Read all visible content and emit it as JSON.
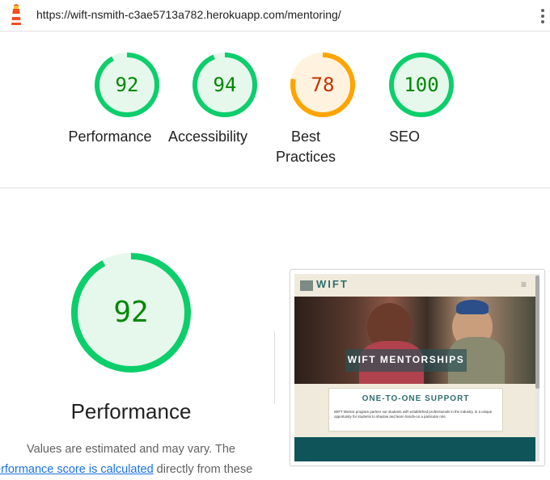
{
  "url_bar": {
    "url": "https://wift-nsmith-c3ae5713a782.herokuapp.com/mentoring/",
    "logo_icon": "lighthouse-icon",
    "menu_icon": "kebab-menu-icon"
  },
  "gauges": [
    {
      "label": "Performance",
      "score": "92",
      "color": "#0cce6b",
      "text_color": "#008800",
      "fill": "#e6f7ec"
    },
    {
      "label": "Accessibility",
      "score": "94",
      "color": "#0cce6b",
      "text_color": "#008800",
      "fill": "#e6f7ec"
    },
    {
      "label": "Best Practices",
      "score": "78",
      "color": "#ffa400",
      "text_color": "#c33300",
      "fill": "#fff3e0"
    },
    {
      "label": "SEO",
      "score": "100",
      "color": "#0cce6b",
      "text_color": "#008800",
      "fill": "#e6f7ec"
    }
  ],
  "performance_section": {
    "score": "92",
    "title": "Performance",
    "desc_line1": "Values are estimated and may vary. The",
    "desc_link": "erformance score is calculated",
    "desc_after_link": " directly from these"
  },
  "thumbnail": {
    "logo_text": "WIFT",
    "menu_glyph": "≡",
    "banner_text": "WIFT MENTORSHIPS",
    "card_title": "ONE-TO-ONE SUPPORT",
    "card_text": "WIFT Mentor program partner our students with established professionals in the industry, in a unique opportunity for students to shadow and learn hands-on a particular role."
  }
}
